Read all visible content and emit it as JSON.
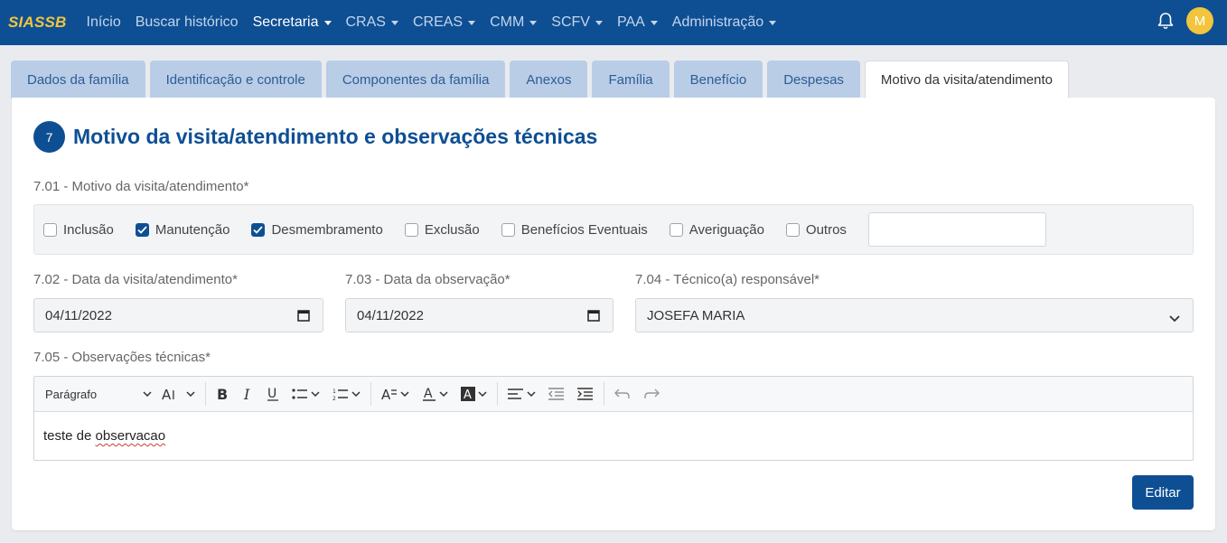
{
  "navbar": {
    "brand": "SIASSB",
    "items": [
      {
        "label": "Início"
      },
      {
        "label": "Buscar histórico"
      },
      {
        "label": "Secretaria"
      },
      {
        "label": "CRAS"
      },
      {
        "label": "CREAS"
      },
      {
        "label": "CMM"
      },
      {
        "label": "SCFV"
      },
      {
        "label": "PAA"
      },
      {
        "label": "Administração"
      }
    ],
    "avatar_initial": "M"
  },
  "tabs": [
    {
      "label": "Dados da família"
    },
    {
      "label": "Identificação e controle"
    },
    {
      "label": "Componentes da família"
    },
    {
      "label": "Anexos"
    },
    {
      "label": "Família"
    },
    {
      "label": "Benefício"
    },
    {
      "label": "Despesas"
    },
    {
      "label": "Motivo da visita/atendimento"
    }
  ],
  "section": {
    "number": "7",
    "title": "Motivo da visita/atendimento e observações técnicas"
  },
  "fields": {
    "motivo": {
      "label": "7.01 - Motivo da visita/atendimento*",
      "options": [
        {
          "label": "Inclusão",
          "checked": false
        },
        {
          "label": "Manutenção",
          "checked": true
        },
        {
          "label": "Desmembramento",
          "checked": true
        },
        {
          "label": "Exclusão",
          "checked": false
        },
        {
          "label": "Benefícios Eventuais",
          "checked": false
        },
        {
          "label": "Averiguação",
          "checked": false
        },
        {
          "label": "Outros",
          "checked": false
        }
      ],
      "outros_value": ""
    },
    "data_visita": {
      "label": "7.02 - Data da visita/atendimento*",
      "value": "04/11/2022"
    },
    "data_observacao": {
      "label": "7.03 - Data da observação*",
      "value": "04/11/2022"
    },
    "tecnico": {
      "label": "7.04 - Técnico(a) responsável*",
      "value": "JOSEFA MARIA"
    },
    "observacoes": {
      "label": "7.05 - Observações técnicas*",
      "paragraph_style": "Parágrafo",
      "content_prefix": "teste de ",
      "content_misspelled": "observacao"
    }
  },
  "actions": {
    "edit_label": "Editar"
  },
  "colors": {
    "navbar": "#0e4f94",
    "brand": "#f2c53d",
    "tab_inactive": "#b9cde6",
    "primary": "#0e4f94"
  }
}
